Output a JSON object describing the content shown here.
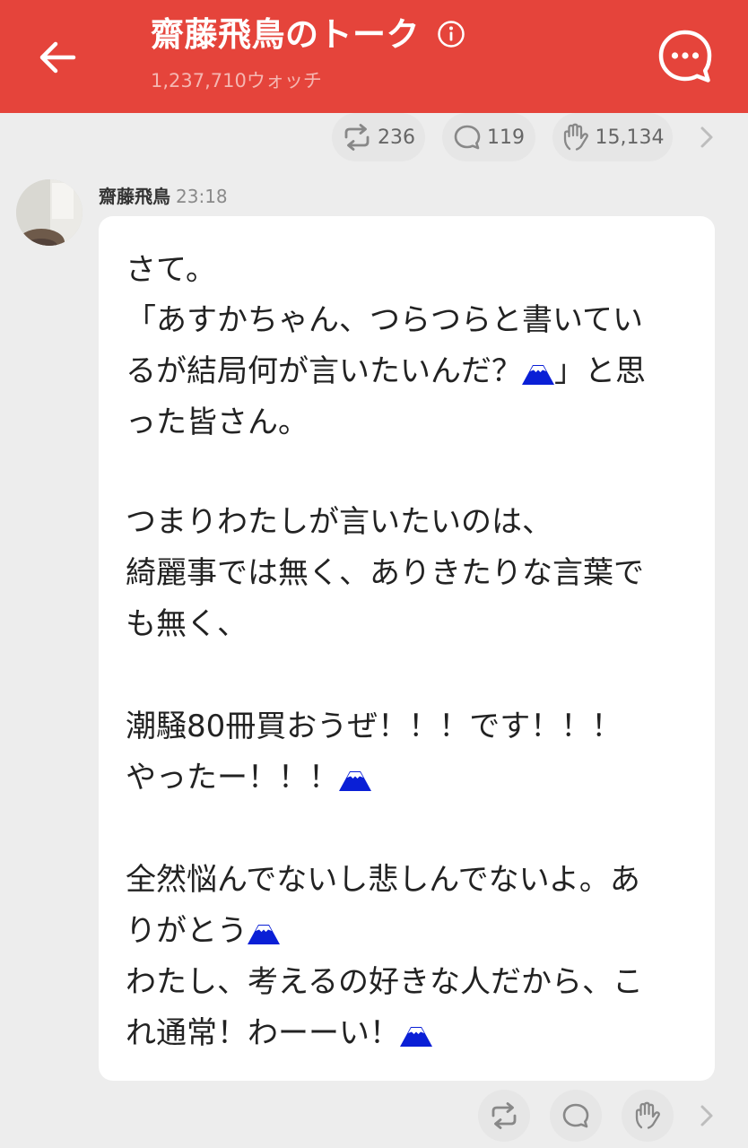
{
  "header": {
    "title": "齋藤飛鳥のトーク",
    "watch_count": "1,237,710ウォッチ",
    "accent_color": "#e5443b",
    "icons": [
      "back-arrow-icon",
      "info-icon",
      "talk-bubble-icon"
    ]
  },
  "reactions_top": {
    "share_count": "236",
    "comment_count": "119",
    "clap_count": "15,134"
  },
  "message": {
    "sender": "齋藤飛鳥",
    "time": "23:18",
    "lines": [
      {
        "text": "さて。",
        "emoji": false
      },
      {
        "text": "「あすかちゃん、つらつらと書いてい",
        "emoji": false
      },
      {
        "text": "るが結局何が言いたいんだ？",
        "emoji": true,
        "after": "」と思"
      },
      {
        "text": "った皆さん。",
        "emoji": false
      },
      {
        "text": "つまりわたしが言いたいのは、",
        "emoji": false
      },
      {
        "text": "綺麗事では無く、ありきたりな言葉で",
        "emoji": false
      },
      {
        "text": "も無く、",
        "emoji": false
      },
      {
        "text": "潮騒80冊買おうぜ！！！です！！！",
        "emoji": false
      },
      {
        "text": "やったー！！！",
        "emoji": true
      },
      {
        "text": "全然悩んでないし悲しんでないよ。あ",
        "emoji": false
      },
      {
        "text": "りがとう",
        "emoji": true
      },
      {
        "text": "わたし、考えるの好きな人だから、こ",
        "emoji": false
      },
      {
        "text": "れ通常！わーーい！",
        "emoji": true
      }
    ],
    "emoji_name": "mount-fuji-icon",
    "emoji_color": "#0a1fd6"
  },
  "reactions_bottom": {
    "icons": [
      "share-icon",
      "comment-icon",
      "clap-icon",
      "chevron-right-icon"
    ]
  }
}
